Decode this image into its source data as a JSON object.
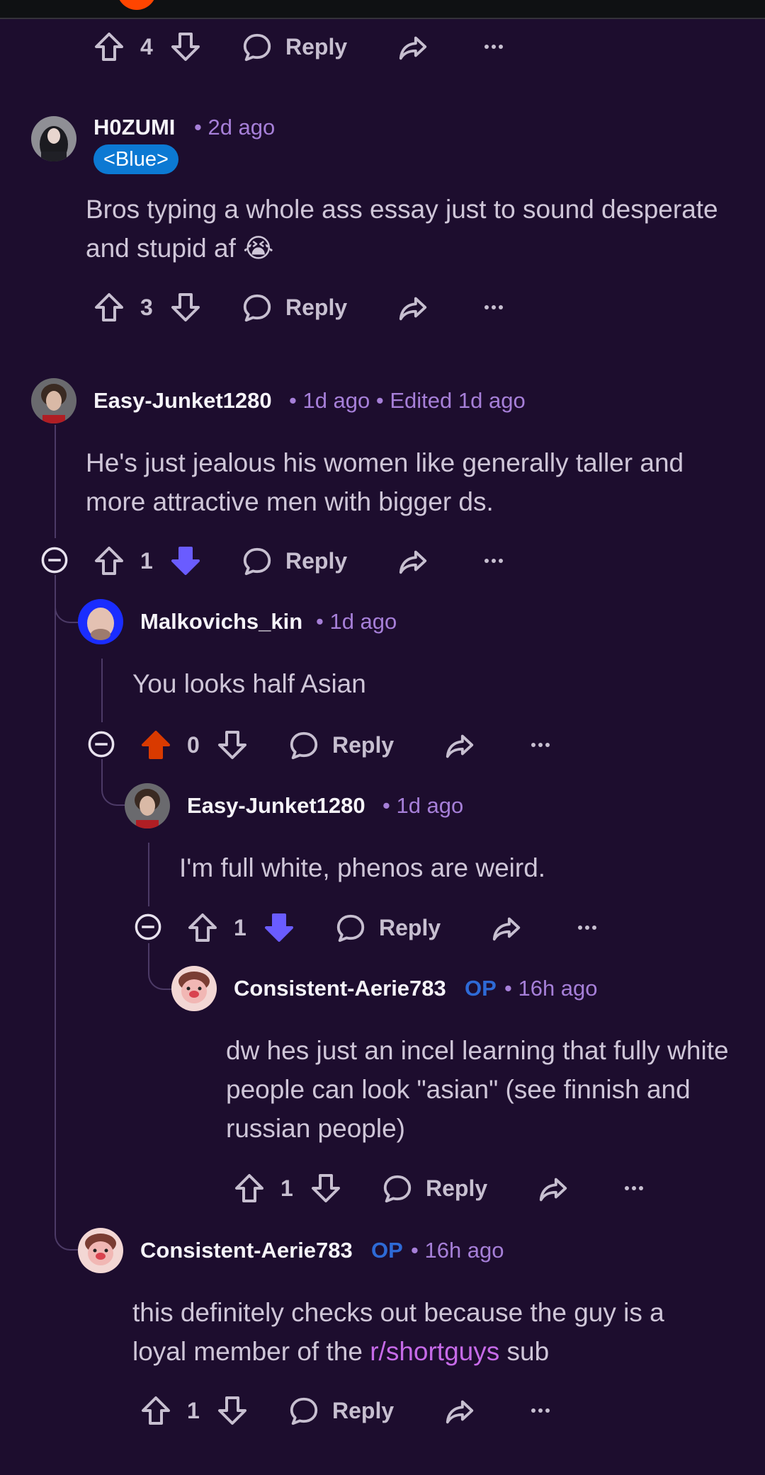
{
  "comments": [
    {
      "id": "c0",
      "action_bar": {
        "votes": "4",
        "upvote_state": "none",
        "downvote_state": "none",
        "reply_label": "Reply"
      }
    },
    {
      "id": "c1",
      "username": "H0ZUMI",
      "meta": "• 2d ago",
      "flair": "<Blue>",
      "body": "Bros typing a whole ass essay just to sound desperate and stupid af 😭",
      "action_bar": {
        "votes": "3",
        "upvote_state": "none",
        "downvote_state": "none",
        "reply_label": "Reply"
      }
    },
    {
      "id": "c2",
      "username": "Easy-Junket1280",
      "meta": "• 1d ago • Edited 1d ago",
      "body": "He's just jealous his women like generally taller and more attractive men with bigger ds.",
      "action_bar": {
        "votes": "1",
        "upvote_state": "none",
        "downvote_state": "active",
        "reply_label": "Reply"
      }
    },
    {
      "id": "c3",
      "username": "Malkovichs_kin",
      "meta": "• 1d ago",
      "body": "You looks half Asian",
      "action_bar": {
        "votes": "0",
        "upvote_state": "active",
        "downvote_state": "none",
        "reply_label": "Reply"
      }
    },
    {
      "id": "c4",
      "username": "Easy-Junket1280",
      "meta": "• 1d ago",
      "body": "I'm full white, phenos are weird.",
      "action_bar": {
        "votes": "1",
        "upvote_state": "none",
        "downvote_state": "active",
        "reply_label": "Reply"
      }
    },
    {
      "id": "c5",
      "username": "Consistent-Aerie783",
      "op_label": "OP",
      "meta": "• 16h ago",
      "body": "dw hes just an incel learning that fully white people can look \"asian\" (see finnish and russian people)",
      "action_bar": {
        "votes": "1",
        "upvote_state": "none",
        "downvote_state": "none",
        "reply_label": "Reply"
      }
    },
    {
      "id": "c6",
      "username": "Consistent-Aerie783",
      "op_label": "OP",
      "meta": "• 16h ago",
      "body_prefix": "this definitely checks out because the guy is a loyal member of the ",
      "body_link": "r/shortguys",
      "body_suffix": " sub",
      "action_bar": {
        "votes": "1",
        "upvote_state": "none",
        "downvote_state": "none",
        "reply_label": "Reply"
      }
    }
  ],
  "colors": {
    "background": "#1d0d2e",
    "upvote_active": "#d93a00",
    "downvote_active": "#6a5cff",
    "meta": "#a67fd8",
    "op": "#2e6ad6",
    "link": "#c66ae8"
  },
  "icons": [
    "upvote-icon",
    "downvote-icon",
    "reply-bubble-icon",
    "share-icon",
    "more-icon",
    "collapse-icon"
  ]
}
